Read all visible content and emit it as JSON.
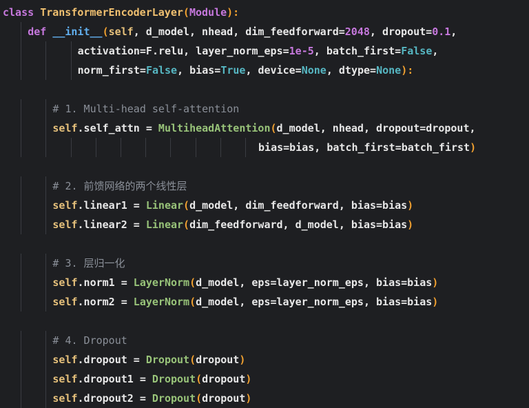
{
  "lines": [
    {
      "indent": 0,
      "segments": [
        {
          "t": "class ",
          "c": "kw"
        },
        {
          "t": "TransformerEncoderLayer",
          "c": "cls"
        },
        {
          "t": "(",
          "c": "paren"
        },
        {
          "t": "Module",
          "c": "base"
        },
        {
          "t": "):",
          "c": "paren"
        }
      ]
    },
    {
      "indent": 1,
      "segments": [
        {
          "t": "def ",
          "c": "kw"
        },
        {
          "t": "__init__",
          "c": "fn"
        },
        {
          "t": "(",
          "c": "paren"
        },
        {
          "t": "self",
          "c": "self"
        },
        {
          "t": ", d_model, nhead, dim_feedforward=",
          "c": "plain"
        },
        {
          "t": "2048",
          "c": "num"
        },
        {
          "t": ", dropout=",
          "c": "plain"
        },
        {
          "t": "0.1",
          "c": "num"
        },
        {
          "t": ",",
          "c": "plain"
        }
      ]
    },
    {
      "indent": 3,
      "segments": [
        {
          "t": "activation=F.relu, layer_norm_eps=",
          "c": "plain"
        },
        {
          "t": "1e-5",
          "c": "num"
        },
        {
          "t": ", batch_first=",
          "c": "plain"
        },
        {
          "t": "False",
          "c": "const"
        },
        {
          "t": ",",
          "c": "plain"
        }
      ]
    },
    {
      "indent": 3,
      "segments": [
        {
          "t": "norm_first=",
          "c": "plain"
        },
        {
          "t": "False",
          "c": "const"
        },
        {
          "t": ", bias=",
          "c": "plain"
        },
        {
          "t": "True",
          "c": "const"
        },
        {
          "t": ", device=",
          "c": "plain"
        },
        {
          "t": "None",
          "c": "const"
        },
        {
          "t": ", dtype=",
          "c": "plain"
        },
        {
          "t": "None",
          "c": "const"
        },
        {
          "t": "):",
          "c": "paren"
        }
      ]
    },
    {
      "indent": 0,
      "segments": []
    },
    {
      "indent": 2,
      "segments": [
        {
          "t": "# 1. Multi-head self-attention",
          "c": "cmt"
        }
      ]
    },
    {
      "indent": 2,
      "segments": [
        {
          "t": "self",
          "c": "self"
        },
        {
          "t": ".self_attn = ",
          "c": "plain"
        },
        {
          "t": "MultiheadAttention",
          "c": "call"
        },
        {
          "t": "(",
          "c": "paren"
        },
        {
          "t": "d_model, nhead, dropout=dropout,",
          "c": "plain"
        }
      ]
    },
    {
      "indent": 10,
      "segments": [
        {
          "t": " bias=bias, batch_first=batch_first",
          "c": "plain"
        },
        {
          "t": ")",
          "c": "paren"
        }
      ]
    },
    {
      "indent": 0,
      "segments": []
    },
    {
      "indent": 2,
      "segments": [
        {
          "t": "# 2. 前馈网络的两个线性层",
          "c": "cmt"
        }
      ]
    },
    {
      "indent": 2,
      "segments": [
        {
          "t": "self",
          "c": "self"
        },
        {
          "t": ".linear1 = ",
          "c": "plain"
        },
        {
          "t": "Linear",
          "c": "call"
        },
        {
          "t": "(",
          "c": "paren"
        },
        {
          "t": "d_model, dim_feedforward, bias=bias",
          "c": "plain"
        },
        {
          "t": ")",
          "c": "paren"
        }
      ]
    },
    {
      "indent": 2,
      "segments": [
        {
          "t": "self",
          "c": "self"
        },
        {
          "t": ".linear2 = ",
          "c": "plain"
        },
        {
          "t": "Linear",
          "c": "call"
        },
        {
          "t": "(",
          "c": "paren"
        },
        {
          "t": "dim_feedforward, d_model, bias=bias",
          "c": "plain"
        },
        {
          "t": ")",
          "c": "paren"
        }
      ]
    },
    {
      "indent": 0,
      "segments": []
    },
    {
      "indent": 2,
      "segments": [
        {
          "t": "# 3. 层归一化",
          "c": "cmt"
        }
      ]
    },
    {
      "indent": 2,
      "segments": [
        {
          "t": "self",
          "c": "self"
        },
        {
          "t": ".norm1 = ",
          "c": "plain"
        },
        {
          "t": "LayerNorm",
          "c": "call"
        },
        {
          "t": "(",
          "c": "paren"
        },
        {
          "t": "d_model, eps=layer_norm_eps, bias=bias",
          "c": "plain"
        },
        {
          "t": ")",
          "c": "paren"
        }
      ]
    },
    {
      "indent": 2,
      "segments": [
        {
          "t": "self",
          "c": "self"
        },
        {
          "t": ".norm2 = ",
          "c": "plain"
        },
        {
          "t": "LayerNorm",
          "c": "call"
        },
        {
          "t": "(",
          "c": "paren"
        },
        {
          "t": "d_model, eps=layer_norm_eps, bias=bias",
          "c": "plain"
        },
        {
          "t": ")",
          "c": "paren"
        }
      ]
    },
    {
      "indent": 0,
      "segments": []
    },
    {
      "indent": 2,
      "segments": [
        {
          "t": "# 4. Dropout",
          "c": "cmt"
        }
      ]
    },
    {
      "indent": 2,
      "segments": [
        {
          "t": "self",
          "c": "self"
        },
        {
          "t": ".dropout = ",
          "c": "plain"
        },
        {
          "t": "Dropout",
          "c": "call"
        },
        {
          "t": "(",
          "c": "paren"
        },
        {
          "t": "dropout",
          "c": "plain"
        },
        {
          "t": ")",
          "c": "paren"
        }
      ]
    },
    {
      "indent": 2,
      "segments": [
        {
          "t": "self",
          "c": "self"
        },
        {
          "t": ".dropout1 = ",
          "c": "plain"
        },
        {
          "t": "Dropout",
          "c": "call"
        },
        {
          "t": "(",
          "c": "paren"
        },
        {
          "t": "dropout",
          "c": "plain"
        },
        {
          "t": ")",
          "c": "paren"
        }
      ]
    },
    {
      "indent": 2,
      "segments": [
        {
          "t": "self",
          "c": "self"
        },
        {
          "t": ".dropout2 = ",
          "c": "plain"
        },
        {
          "t": "Dropout",
          "c": "call"
        },
        {
          "t": "(",
          "c": "paren"
        },
        {
          "t": "dropout",
          "c": "plain"
        },
        {
          "t": ")",
          "c": "paren"
        }
      ]
    }
  ]
}
